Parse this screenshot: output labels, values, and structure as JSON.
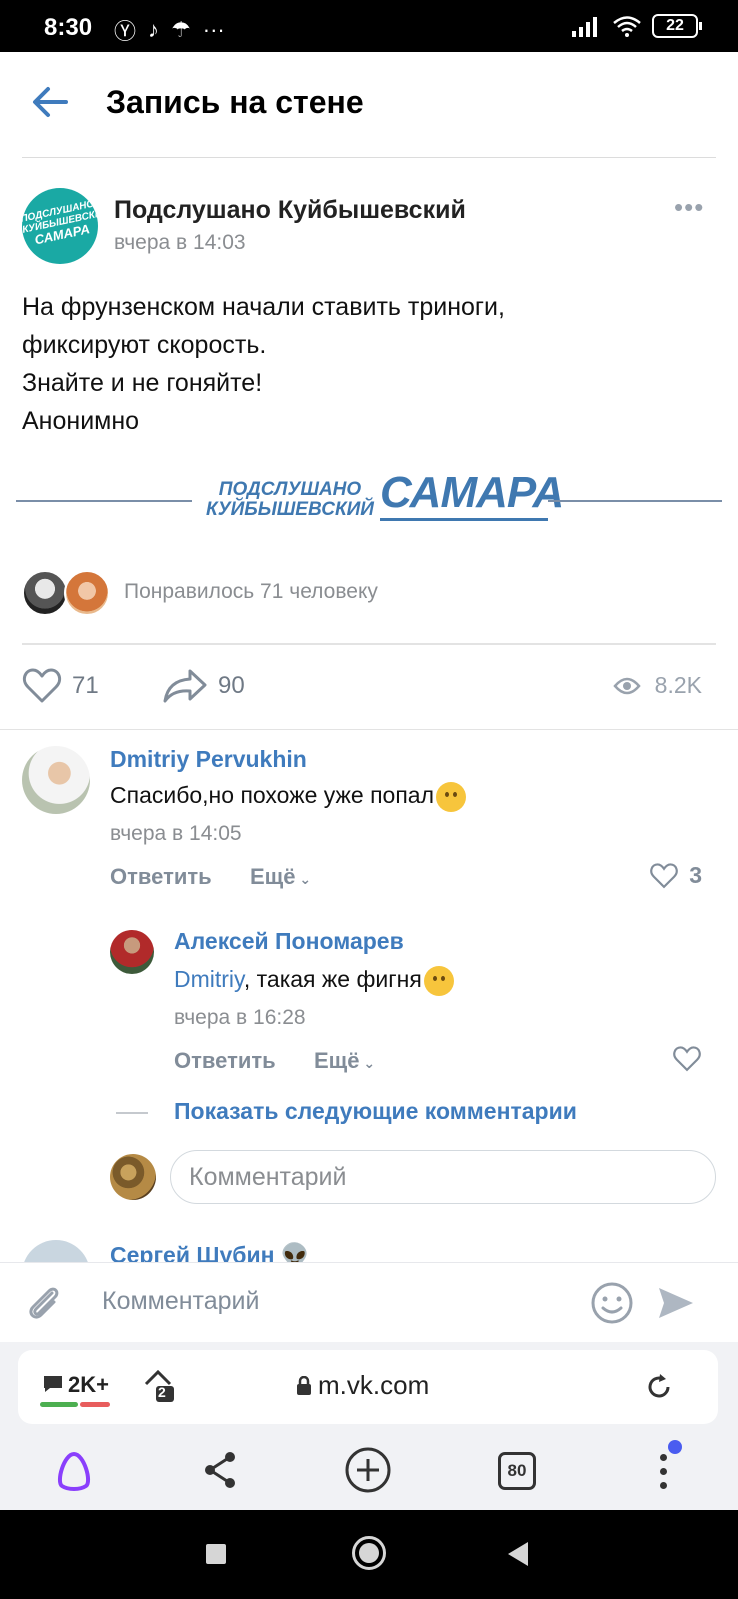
{
  "status_bar": {
    "time": "8:30",
    "battery": "22"
  },
  "header": {
    "title": "Запись на стене"
  },
  "post": {
    "author": "Подслушано Куйбышевский",
    "time": "вчера в 14:03",
    "avatar_text": [
      "ПОДСЛУШАНО",
      "КУЙБЫШЕВСКИЙ",
      "САМАРА"
    ],
    "text_lines": [
      "На фрунзенском начали ставить триноги,",
      "фиксируют скорость.",
      "Знайте и не гоняйте!",
      "Анонимно"
    ],
    "banner": {
      "line1": "ПОДСЛУШАНО",
      "line2": "КУЙБЫШЕВСКИЙ",
      "big": "САМАРА"
    },
    "liked_by": "Понравилось 71 человеку",
    "likes": "71",
    "shares": "90",
    "views": "8.2K"
  },
  "comments": [
    {
      "author": "Dmitriy Pervukhin",
      "text": "Спасибо,но похоже уже попал",
      "time": "вчера в 14:05",
      "reply": "Ответить",
      "more": "Ещё",
      "likes": "3"
    },
    {
      "author": "Алексей Пономарев",
      "mention": "Dmitriy",
      "text": ", такая же фигня",
      "time": "вчера в 16:28",
      "reply": "Ответить",
      "more": "Ещё"
    }
  ],
  "show_more": "Показать следующие комментарии",
  "reply_placeholder": "Комментарий",
  "next_comment_author": "Сергей Шубин",
  "compose_placeholder": "Комментарий",
  "browser": {
    "comments_count": "2K+",
    "tabs_badge": "2",
    "url": "m.vk.com",
    "tabs_count": "80"
  },
  "colors": {
    "link": "#3f7bbd",
    "muted": "#8a8d91",
    "group_avatar": "#1aa9a4",
    "alice": "#8a3ffc"
  }
}
